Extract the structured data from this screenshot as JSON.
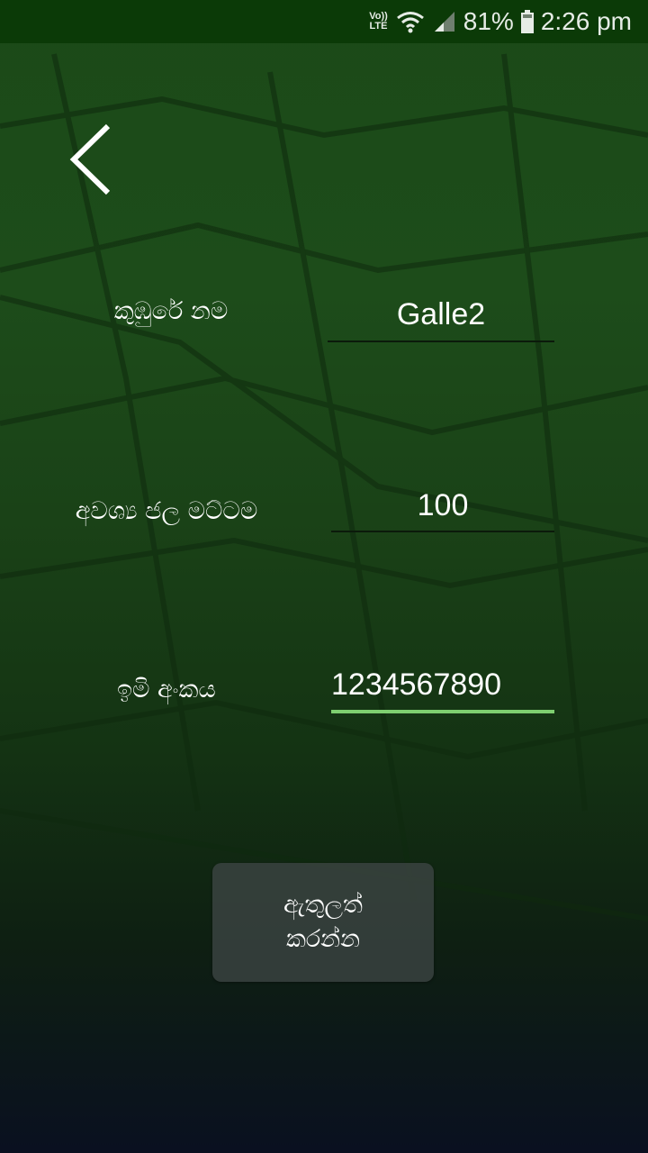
{
  "status_bar": {
    "volte_top": "Vo))",
    "volte_bottom": "LTE",
    "battery_percent": "81%",
    "time": "2:26 pm",
    "icons": [
      "volte-icon",
      "wifi-icon",
      "signal-icon",
      "battery-icon"
    ]
  },
  "form": {
    "cluster_name_label": "කුඹුරේ නම",
    "cluster_name_value": "Galle2",
    "water_level_label": "අවශ්‍ය ජල මට්ටම",
    "water_level_value": "100",
    "sim_number_label": "ඉමි අංකය",
    "sim_number_value": "1234567890",
    "submit_line1": "ඇතුලත්",
    "submit_line2": "කරන්න"
  },
  "colors": {
    "status_bar_bg": "#0b3a07",
    "active_underline": "#7ecf70",
    "button_bg": "#414848"
  }
}
